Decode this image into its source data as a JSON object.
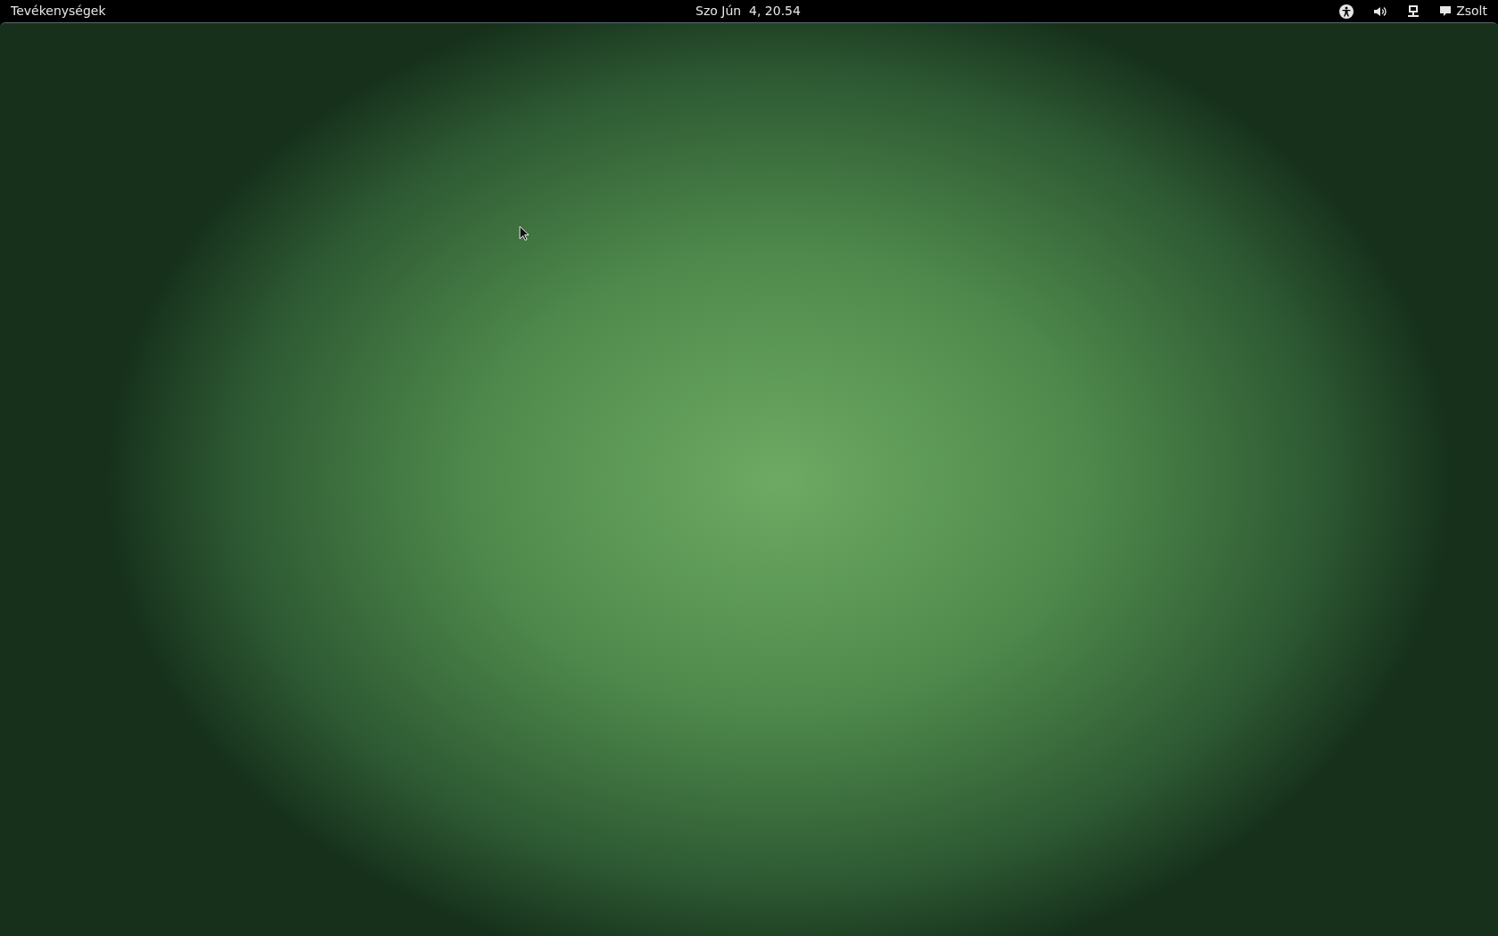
{
  "top_bar": {
    "activities": "Tevékenységek",
    "clock": "Szo Jún  4, 20.54",
    "user_name": "Zsolt"
  }
}
